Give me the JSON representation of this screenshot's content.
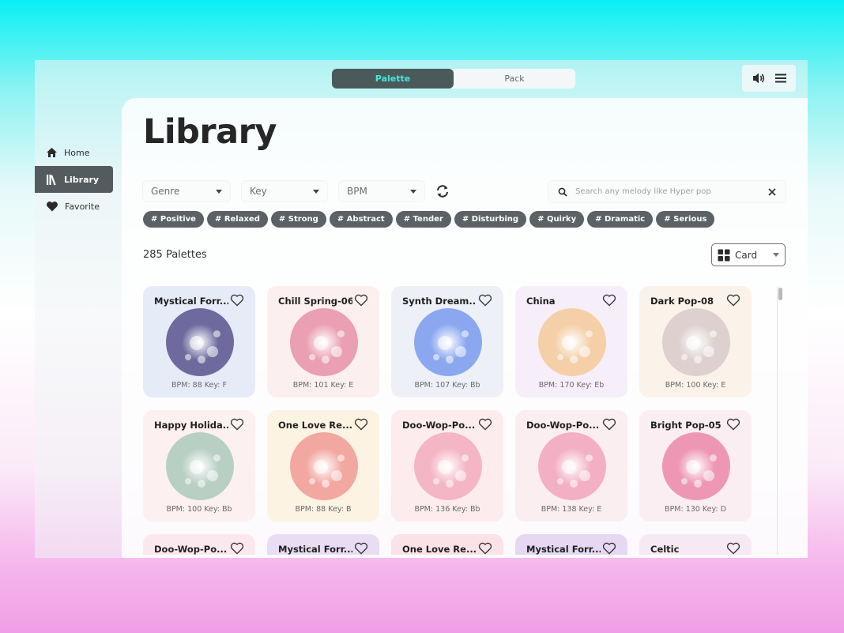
{
  "topbar": {
    "tabs": [
      {
        "label": "Palette",
        "active": true
      },
      {
        "label": "Pack",
        "active": false
      }
    ],
    "icons": [
      "volume-icon",
      "menu-icon"
    ]
  },
  "sidebar": {
    "items": [
      {
        "label": "Home",
        "icon": "home-icon",
        "active": false
      },
      {
        "label": "Library",
        "icon": "library-icon",
        "active": true
      },
      {
        "label": "Favorite",
        "icon": "heart-icon",
        "active": false
      }
    ]
  },
  "main": {
    "title": "Library",
    "filters": {
      "genre": "Genre",
      "key": "Key",
      "bpm": "BPM"
    },
    "search": {
      "placeholder": "Search any melody like Hyper pop"
    },
    "tags": [
      "# Positive",
      "# Relaxed",
      "# Strong",
      "# Abstract",
      "# Tender",
      "# Disturbing",
      "# Quirky",
      "# Dramatic",
      "# Serious"
    ],
    "count_label": "285 Palettes",
    "view": {
      "label": "Card"
    },
    "colors": {
      "accent": "#48e6e0",
      "active_dark": "#4a5a5a",
      "tag_bg": "#5b6164"
    },
    "cards": [
      {
        "title": "Mystical Forr...",
        "meta": "BPM: 88 Key: F",
        "bg": "#e6ebf8",
        "orb": "#6e6a9e"
      },
      {
        "title": "Chill Spring-06",
        "meta": "BPM: 101 Key: E",
        "bg": "#fcefef",
        "orb": "#ea9fb2"
      },
      {
        "title": "Synth Dream...",
        "meta": "BPM: 107 Key: Bb",
        "bg": "#eef0f8",
        "orb": "#8aa7f0"
      },
      {
        "title": "China",
        "meta": "BPM: 170 Key: Eb",
        "bg": "#f6eef8",
        "orb": "#f4cfa8"
      },
      {
        "title": "Dark Pop-08",
        "meta": "BPM: 100 Key: E",
        "bg": "#fbf2ea",
        "orb": "#ddd0cf"
      },
      {
        "title": "Happy Holida...",
        "meta": "BPM: 100 Key: Bb",
        "bg": "#fdf0f0",
        "orb": "#b8cfc4"
      },
      {
        "title": "One Love Re...",
        "meta": "BPM: 88 Key: B",
        "bg": "#fdf3e3",
        "orb": "#f2a7a0"
      },
      {
        "title": "Doo-Wop-Po...",
        "meta": "BPM: 136 Key: Bb",
        "bg": "#fceced",
        "orb": "#f4b6c4"
      },
      {
        "title": "Doo-Wop-Po...",
        "meta": "BPM: 138 Key: E",
        "bg": "#fbeef1",
        "orb": "#f3b0c4"
      },
      {
        "title": "Bright Pop-05",
        "meta": "BPM: 130 Key: D",
        "bg": "#fbeef3",
        "orb": "#ee97b4"
      },
      {
        "title": "Doo-Wop-Po...",
        "meta": "",
        "bg": "#fbe8ee",
        "orb": "#f4b6c4"
      },
      {
        "title": "Mystical Forr...",
        "meta": "",
        "bg": "#e9ddf4",
        "orb": "#b59ce0"
      },
      {
        "title": "One Love Re...",
        "meta": "",
        "bg": "#fbe2e6",
        "orb": "#f2a7a0"
      },
      {
        "title": "Mystical Forr...",
        "meta": "",
        "bg": "#e6d7f3",
        "orb": "#b59ce0"
      },
      {
        "title": "Celtic",
        "meta": "",
        "bg": "#f6e9f4",
        "orb": "#d9c3e4"
      }
    ]
  }
}
